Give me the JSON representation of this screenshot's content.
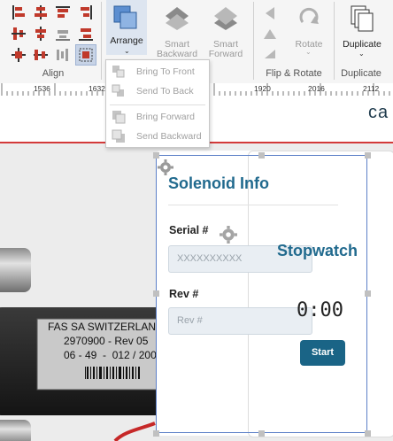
{
  "ribbon": {
    "arrange_label": "Arrange",
    "smart_backward_label": "Smart Backward",
    "smart_forward_label": "Smart Forward",
    "rotate_label": "Rotate",
    "duplicate_label": "Duplicate",
    "groups": {
      "align": "Align",
      "flip_rotate": "Flip & Rotate",
      "duplicate": "Duplicate"
    }
  },
  "ruler": {
    "ticks": [
      "1536",
      "1632",
      "1920",
      "2016",
      "2112"
    ]
  },
  "header": {
    "brand_text": "ca"
  },
  "arrange_menu": {
    "items": [
      "Bring To Front",
      "Send To Back",
      "Bring Forward",
      "Send Backward"
    ]
  },
  "form": {
    "title": "Solenoid Info",
    "serial_label": "Serial #",
    "serial_placeholder": "XXXXXXXXXX",
    "rev_label": "Rev #",
    "rev_placeholder": "Rev #"
  },
  "stopwatch": {
    "title": "Stopwatch",
    "time": "0:00",
    "start_label": "Start"
  },
  "device_label": {
    "line1": "FAS SA SWITZERLAN",
    "line2": "2970900 - Rev 05",
    "line3": "06 - 49  -  012 / 200"
  },
  "colors": {
    "accent": "#216a8e",
    "button": "#1a6486",
    "selection": "#5d80c8",
    "header_rule": "#d33a3a"
  }
}
